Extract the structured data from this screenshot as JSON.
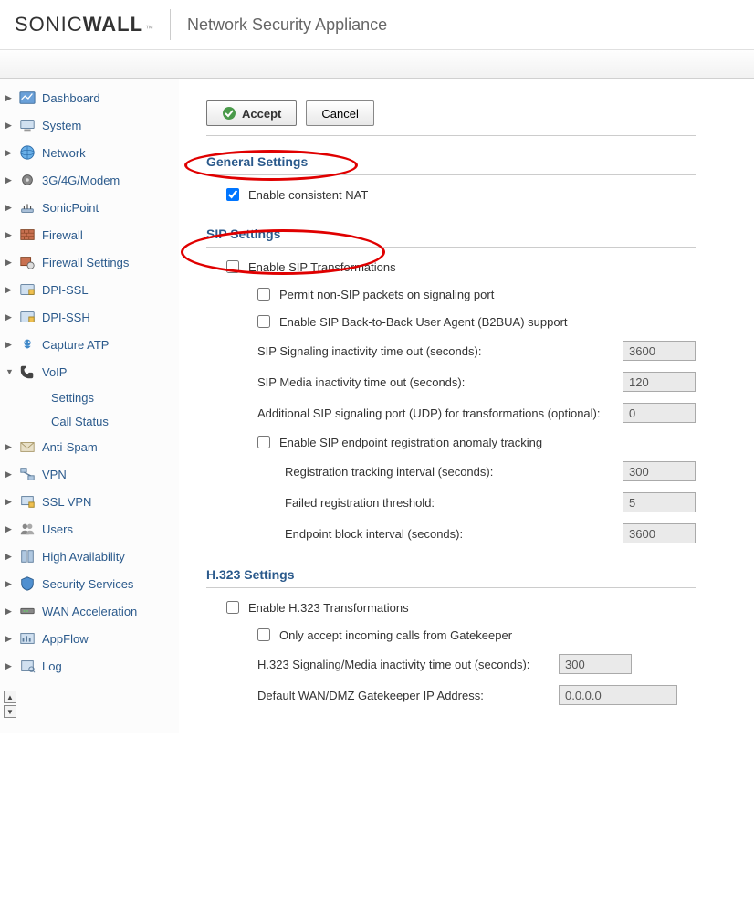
{
  "header": {
    "brand_main": "SONIC",
    "brand_bold": "WALL",
    "title": "Network Security Appliance"
  },
  "sidebar": {
    "items": [
      {
        "label": "Dashboard",
        "icon": "dashboard"
      },
      {
        "label": "System",
        "icon": "system"
      },
      {
        "label": "Network",
        "icon": "network"
      },
      {
        "label": "3G/4G/Modem",
        "icon": "modem"
      },
      {
        "label": "SonicPoint",
        "icon": "sonicpoint"
      },
      {
        "label": "Firewall",
        "icon": "firewall"
      },
      {
        "label": "Firewall Settings",
        "icon": "firewall-settings"
      },
      {
        "label": "DPI-SSL",
        "icon": "dpi-ssl"
      },
      {
        "label": "DPI-SSH",
        "icon": "dpi-ssh"
      },
      {
        "label": "Capture ATP",
        "icon": "capture"
      },
      {
        "label": "VoIP",
        "icon": "voip",
        "expanded": true,
        "children": [
          {
            "label": "Settings"
          },
          {
            "label": "Call Status"
          }
        ]
      },
      {
        "label": "Anti-Spam",
        "icon": "antispam"
      },
      {
        "label": "VPN",
        "icon": "vpn"
      },
      {
        "label": "SSL VPN",
        "icon": "sslvpn"
      },
      {
        "label": "Users",
        "icon": "users"
      },
      {
        "label": "High Availability",
        "icon": "ha"
      },
      {
        "label": "Security Services",
        "icon": "security"
      },
      {
        "label": "WAN Acceleration",
        "icon": "wan"
      },
      {
        "label": "AppFlow",
        "icon": "appflow"
      },
      {
        "label": "Log",
        "icon": "log"
      }
    ]
  },
  "buttons": {
    "accept": "Accept",
    "cancel": "Cancel"
  },
  "sections": {
    "general": {
      "title": "General Settings",
      "enable_consistent_nat": {
        "label": "Enable consistent NAT",
        "checked": true
      }
    },
    "sip": {
      "title": "SIP Settings",
      "enable_transformations": {
        "label": "Enable SIP Transformations",
        "checked": false
      },
      "permit_non_sip": {
        "label": "Permit non-SIP packets on signaling port",
        "checked": false
      },
      "enable_b2bua": {
        "label": "Enable SIP Back-to-Back User Agent (B2BUA) support",
        "checked": false
      },
      "signaling_timeout": {
        "label": "SIP Signaling inactivity time out (seconds):",
        "value": "3600"
      },
      "media_timeout": {
        "label": "SIP Media inactivity time out (seconds):",
        "value": "120"
      },
      "additional_port": {
        "label": "Additional SIP signaling port (UDP) for transformations (optional):",
        "value": "0"
      },
      "anomaly_tracking": {
        "label": "Enable SIP endpoint registration anomaly tracking",
        "checked": false
      },
      "reg_interval": {
        "label": "Registration tracking interval (seconds):",
        "value": "300"
      },
      "failed_threshold": {
        "label": "Failed registration threshold:",
        "value": "5"
      },
      "block_interval": {
        "label": "Endpoint block interval (seconds):",
        "value": "3600"
      }
    },
    "h323": {
      "title": "H.323 Settings",
      "enable_transformations": {
        "label": "Enable H.323 Transformations",
        "checked": false
      },
      "gatekeeper_only": {
        "label": "Only accept incoming calls from Gatekeeper",
        "checked": false
      },
      "timeout": {
        "label": "H.323 Signaling/Media inactivity time out (seconds):",
        "value": "300"
      },
      "gatekeeper_ip": {
        "label": "Default WAN/DMZ Gatekeeper IP Address:",
        "value": "0.0.0.0"
      }
    }
  }
}
